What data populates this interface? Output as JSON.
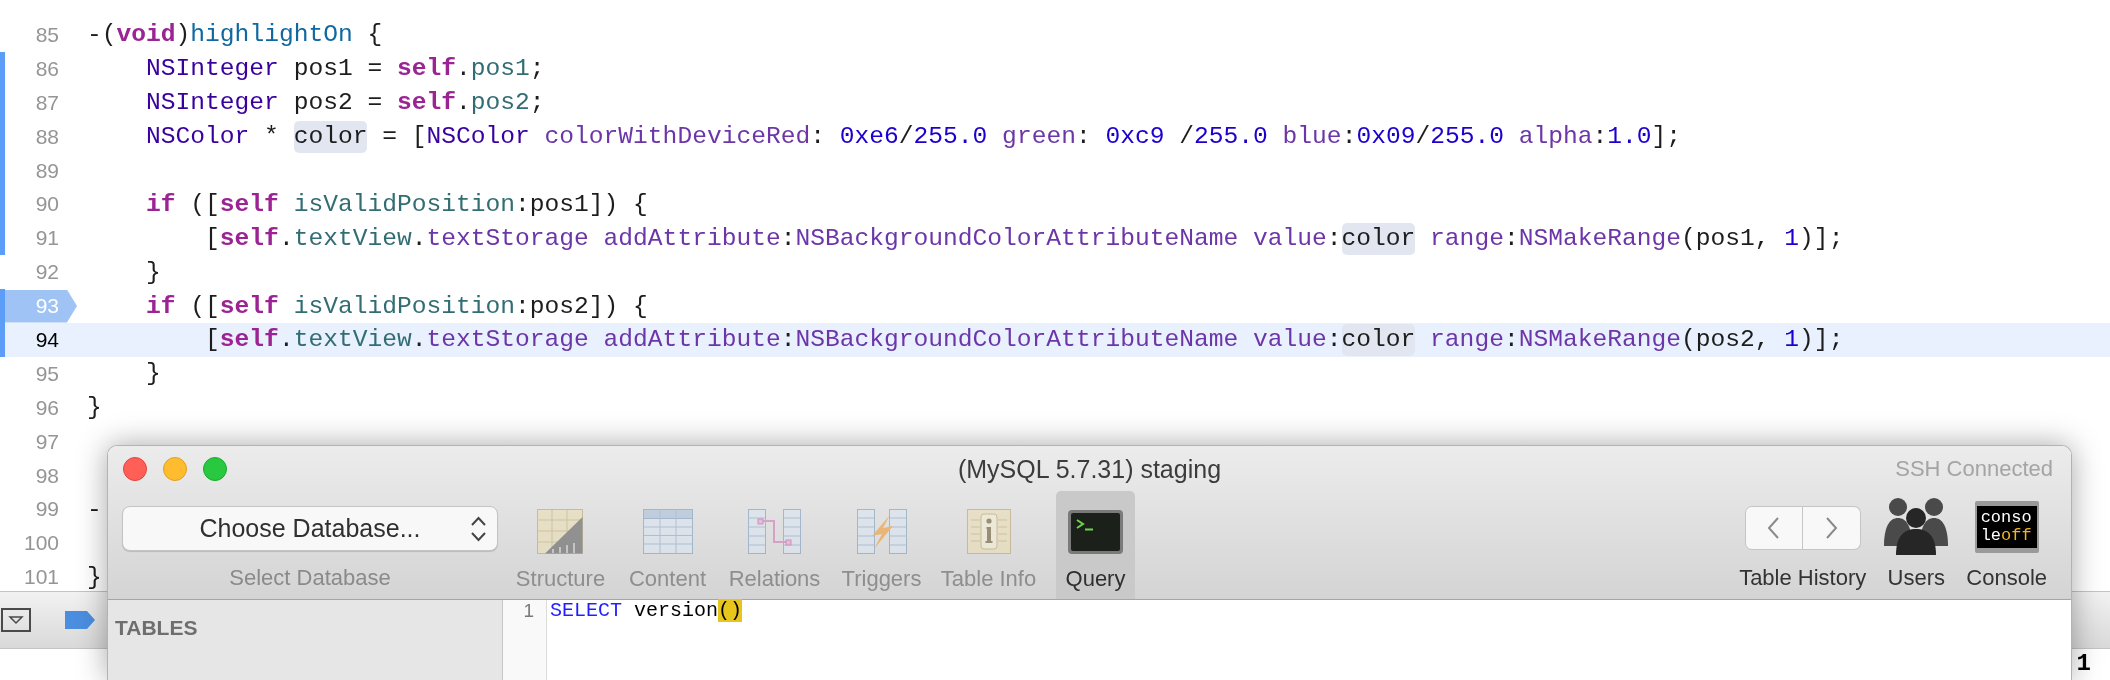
{
  "editor": {
    "code_lines": [
      {
        "number": "85",
        "changed": false,
        "breakpoint": false,
        "current": false,
        "tokens": [
          {
            "text": "-(",
            "kind": "plain"
          },
          {
            "text": "void",
            "kind": "keyword"
          },
          {
            "text": ")",
            "kind": "plain"
          },
          {
            "text": "highlightOn",
            "kind": "declaration"
          },
          {
            "text": " {",
            "kind": "plain"
          }
        ]
      },
      {
        "number": "86",
        "changed": true,
        "breakpoint": false,
        "current": false,
        "tokens": [
          {
            "text": "    NSInteger",
            "kind": "type"
          },
          {
            "text": " pos1 = ",
            "kind": "plain"
          },
          {
            "text": "self",
            "kind": "keyword"
          },
          {
            "text": ".",
            "kind": "plain"
          },
          {
            "text": "pos1",
            "kind": "project"
          },
          {
            "text": ";",
            "kind": "plain"
          }
        ]
      },
      {
        "number": "87",
        "changed": true,
        "breakpoint": false,
        "current": false,
        "tokens": [
          {
            "text": "    NSInteger",
            "kind": "type"
          },
          {
            "text": " pos2 = ",
            "kind": "plain"
          },
          {
            "text": "self",
            "kind": "keyword"
          },
          {
            "text": ".",
            "kind": "plain"
          },
          {
            "text": "pos2",
            "kind": "project"
          },
          {
            "text": ";",
            "kind": "plain"
          }
        ]
      },
      {
        "number": "88",
        "changed": true,
        "breakpoint": false,
        "current": false,
        "tokens": [
          {
            "text": "    NSColor",
            "kind": "type"
          },
          {
            "text": " * ",
            "kind": "plain"
          },
          {
            "text": "color",
            "kind": "occurrence"
          },
          {
            "text": " = [",
            "kind": "plain"
          },
          {
            "text": "NSColor",
            "kind": "type"
          },
          {
            "text": " colorWithDeviceRed",
            "kind": "method"
          },
          {
            "text": ": ",
            "kind": "plain"
          },
          {
            "text": "0xe6",
            "kind": "number"
          },
          {
            "text": "/",
            "kind": "plain"
          },
          {
            "text": "255.0",
            "kind": "number"
          },
          {
            "text": " green",
            "kind": "method"
          },
          {
            "text": ": ",
            "kind": "plain"
          },
          {
            "text": "0xc9",
            "kind": "number"
          },
          {
            "text": " /",
            "kind": "plain"
          },
          {
            "text": "255.0",
            "kind": "number"
          },
          {
            "text": " blue",
            "kind": "method"
          },
          {
            "text": ":",
            "kind": "plain"
          },
          {
            "text": "0x09",
            "kind": "number"
          },
          {
            "text": "/",
            "kind": "plain"
          },
          {
            "text": "255.0",
            "kind": "number"
          },
          {
            "text": " alpha",
            "kind": "method"
          },
          {
            "text": ":",
            "kind": "plain"
          },
          {
            "text": "1.0",
            "kind": "number"
          },
          {
            "text": "];",
            "kind": "plain"
          }
        ]
      },
      {
        "number": "89",
        "changed": true,
        "breakpoint": false,
        "current": false
      },
      {
        "number": "90",
        "changed": true,
        "breakpoint": false,
        "current": false,
        "tokens": [
          {
            "text": "    if",
            "kind": "keyword"
          },
          {
            "text": " ([",
            "kind": "plain"
          },
          {
            "text": "self",
            "kind": "keyword"
          },
          {
            "text": " isValidPosition",
            "kind": "project"
          },
          {
            "text": ":pos1]) {",
            "kind": "plain"
          }
        ]
      },
      {
        "number": "91",
        "changed": true,
        "breakpoint": false,
        "current": false,
        "tokens": [
          {
            "text": "        [",
            "kind": "plain"
          },
          {
            "text": "self",
            "kind": "keyword"
          },
          {
            "text": ".",
            "kind": "plain"
          },
          {
            "text": "textView",
            "kind": "project"
          },
          {
            "text": ".",
            "kind": "plain"
          },
          {
            "text": "textStorage addAttribute",
            "kind": "method"
          },
          {
            "text": ":",
            "kind": "plain"
          },
          {
            "text": "NSBackgroundColorAttributeName value",
            "kind": "method"
          },
          {
            "text": ":",
            "kind": "plain"
          },
          {
            "text": "color",
            "kind": "occurrence"
          },
          {
            "text": " range",
            "kind": "method"
          },
          {
            "text": ":",
            "kind": "plain"
          },
          {
            "text": "NSMakeRange",
            "kind": "method"
          },
          {
            "text": "(pos1, ",
            "kind": "plain"
          },
          {
            "text": "1",
            "kind": "number"
          },
          {
            "text": ")];",
            "kind": "plain"
          }
        ]
      },
      {
        "number": "92",
        "changed": false,
        "breakpoint": false,
        "current": false,
        "tokens": [
          {
            "text": "    }",
            "kind": "plain"
          }
        ]
      },
      {
        "number": "93",
        "changed": true,
        "breakpoint": true,
        "current": false,
        "tokens": [
          {
            "text": "    if",
            "kind": "keyword"
          },
          {
            "text": " ([",
            "kind": "plain"
          },
          {
            "text": "self",
            "kind": "keyword"
          },
          {
            "text": " isValidPosition",
            "kind": "project"
          },
          {
            "text": ":pos2]) {",
            "kind": "plain"
          }
        ]
      },
      {
        "number": "94",
        "changed": true,
        "breakpoint": false,
        "current": true,
        "tokens": [
          {
            "text": "        [",
            "kind": "plain"
          },
          {
            "text": "self",
            "kind": "keyword"
          },
          {
            "text": ".",
            "kind": "plain"
          },
          {
            "text": "textView",
            "kind": "project"
          },
          {
            "text": ".",
            "kind": "plain"
          },
          {
            "text": "textStorage addAttribute",
            "kind": "method"
          },
          {
            "text": ":",
            "kind": "plain"
          },
          {
            "text": "NSBackgroundColorAttributeName value",
            "kind": "method"
          },
          {
            "text": ":",
            "kind": "plain"
          },
          {
            "text": "color",
            "kind": "occurrence"
          },
          {
            "text": " range",
            "kind": "method"
          },
          {
            "text": ":",
            "kind": "plain"
          },
          {
            "text": "NSMakeRange",
            "kind": "method"
          },
          {
            "text": "(pos2, ",
            "kind": "plain"
          },
          {
            "text": "1",
            "kind": "number"
          },
          {
            "text": ")];",
            "kind": "plain"
          }
        ]
      },
      {
        "number": "95",
        "changed": false,
        "breakpoint": false,
        "current": false,
        "tokens": [
          {
            "text": "    }",
            "kind": "plain"
          }
        ]
      },
      {
        "number": "96",
        "changed": false,
        "breakpoint": false,
        "current": false,
        "tokens": [
          {
            "text": "}",
            "kind": "plain"
          }
        ]
      },
      {
        "number": "97",
        "changed": false,
        "breakpoint": false,
        "current": false
      },
      {
        "number": "98",
        "changed": false,
        "breakpoint": false,
        "current": false
      },
      {
        "number": "99",
        "changed": false,
        "breakpoint": false,
        "current": false,
        "tokens": [
          {
            "text": "-",
            "kind": "plain"
          }
        ]
      },
      {
        "number": "100",
        "changed": false,
        "breakpoint": false,
        "current": false
      },
      {
        "number": "101",
        "changed": false,
        "breakpoint": false,
        "current": false,
        "tokens": [
          {
            "text": "}",
            "kind": "plain"
          }
        ]
      }
    ]
  },
  "debug_console": {
    "text": "1"
  },
  "db_window": {
    "title": "(MySQL 5.7.31) staging",
    "connection_status": "SSH Connected",
    "database_popup": {
      "value": "Choose Database...",
      "label": "Select Database"
    },
    "toolbar_items": [
      {
        "label": "Structure",
        "kind": "structure",
        "disabled": true,
        "selected": false
      },
      {
        "label": "Content",
        "kind": "content",
        "disabled": true,
        "selected": false
      },
      {
        "label": "Relations",
        "kind": "relations",
        "disabled": true,
        "selected": false
      },
      {
        "label": "Triggers",
        "kind": "triggers",
        "disabled": true,
        "selected": false
      },
      {
        "label": "Table Info",
        "kind": "info",
        "disabled": true,
        "selected": false
      },
      {
        "label": "Query",
        "kind": "query",
        "disabled": false,
        "selected": true
      }
    ],
    "history": {
      "label": "Table History"
    },
    "users": {
      "label": "Users"
    },
    "console": {
      "label": "Console",
      "screen_text": [
        "conso",
        "le"
      ],
      "screen_status": "off"
    },
    "sidebar": {
      "heading": "TABLES"
    },
    "query_editor": {
      "lines": [
        {
          "number": "1",
          "tokens": [
            {
              "text": "SELECT",
              "kind": "keyword"
            },
            {
              "text": " version",
              "kind": "plain"
            },
            {
              "text": "()",
              "kind": "match"
            }
          ]
        }
      ]
    }
  }
}
